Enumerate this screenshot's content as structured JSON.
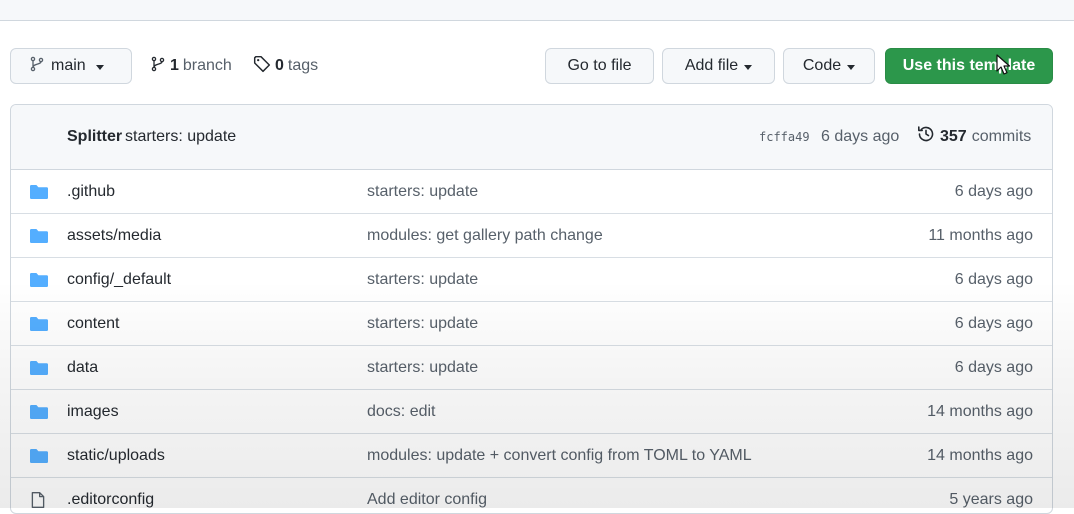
{
  "branch": {
    "name": "main",
    "branch_count": "1",
    "branch_word": "branch",
    "tag_count": "0",
    "tag_word": "tags"
  },
  "toolbar": {
    "go_to_file": "Go to file",
    "add_file": "Add file",
    "code": "Code",
    "use_template": "Use this template"
  },
  "latest_commit": {
    "author": "Splitter",
    "message": "starters: update",
    "sha": "fcffa49",
    "time": "6 days ago",
    "count": "357",
    "count_word": "commits"
  },
  "files": [
    {
      "type": "folder",
      "name": ".github",
      "message": "starters: update",
      "age": "6 days ago"
    },
    {
      "type": "folder",
      "name": "assets/media",
      "message": "modules: get gallery path change",
      "age": "11 months ago"
    },
    {
      "type": "folder",
      "name": "config/_default",
      "message": "starters: update",
      "age": "6 days ago"
    },
    {
      "type": "folder",
      "name": "content",
      "message": "starters: update",
      "age": "6 days ago"
    },
    {
      "type": "folder",
      "name": "data",
      "message": "starters: update",
      "age": "6 days ago"
    },
    {
      "type": "folder",
      "name": "images",
      "message": "docs: edit",
      "age": "14 months ago"
    },
    {
      "type": "folder",
      "name": "static/uploads",
      "message": "modules: update + convert config from TOML to YAML",
      "age": "14 months ago"
    },
    {
      "type": "file",
      "name": ".editorconfig",
      "message": "Add editor config",
      "age": "5 years ago"
    }
  ],
  "colors": {
    "folder": "#54aeff",
    "primary_button": "#2c974b"
  },
  "icons": {
    "branch": "git-branch-icon",
    "tag": "tag-icon",
    "history": "history-icon",
    "folder": "folder-icon",
    "file": "file-icon",
    "cursor": "mouse-cursor-icon"
  }
}
